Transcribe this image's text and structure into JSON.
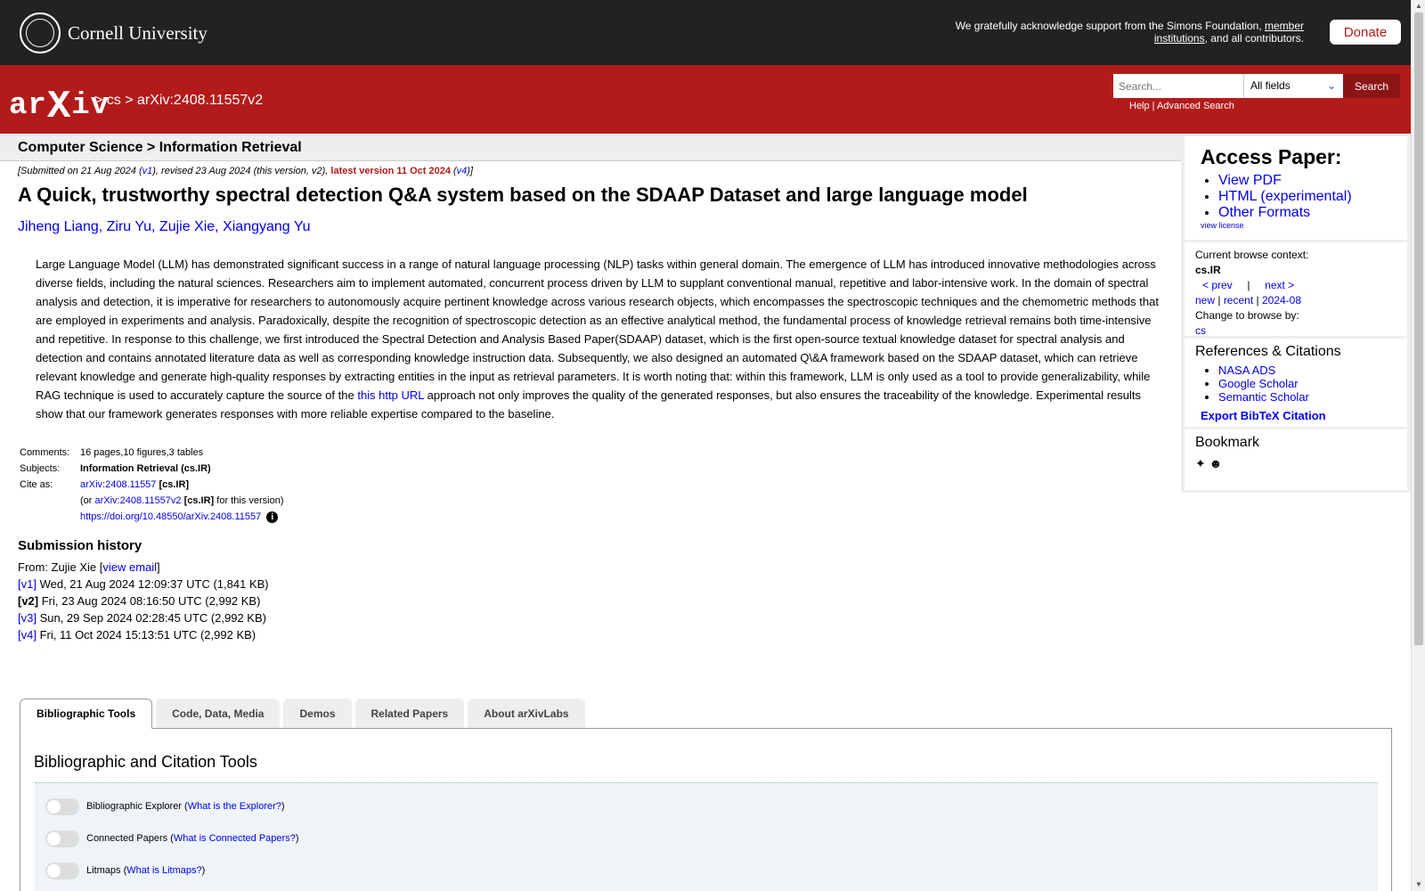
{
  "cornell": {
    "wordmark": "Cornell University",
    "support_pre": "We gratefully acknowledge support from the Simons Foundation, ",
    "support_link": "member institutions",
    "support_post": ", and all contributors.",
    "donate": "Donate"
  },
  "arxiv": {
    "breadcrumb": "> cs > arXiv:2408.11557v2",
    "search_placeholder": "Search...",
    "field_select": "All fields",
    "search_button": "Search",
    "help": "Help",
    "sep": " | ",
    "advanced": "Advanced Search"
  },
  "subject_header": "Computer Science > Information Retrieval",
  "dateline": {
    "part1": "[Submitted on 21 Aug 2024 (",
    "v1": "v1",
    "part2": "), revised 23 Aug 2024 (this version, v2), ",
    "latest": "latest version 11 Oct 2024",
    "part3": " (",
    "v4": "v4",
    "part4": ")]"
  },
  "title": "A Quick, trustworthy spectral detection Q&A system based on the SDAAP Dataset and large language model",
  "authors": "Jiheng Liang, Ziru Yu, Zujie Xie, Xiangyang Yu",
  "abstract": {
    "text_pre": "Large Language Model (LLM) has demonstrated significant success in a range of natural language processing (NLP) tasks within general domain. The emergence of LLM has introduced innovative methodologies across diverse fields, including the natural sciences. Researchers aim to implement automated, concurrent process driven by LLM to supplant conventional manual, repetitive and labor-intensive work. In the domain of spectral analysis and detection, it is imperative for researchers to autonomously acquire pertinent knowledge across various research objects, which encompasses the spectroscopic techniques and the chemometric methods that are employed in experiments and analysis. Paradoxically, despite the recognition of spectroscopic detection as an effective analytical method, the fundamental process of knowledge retrieval remains both time-intensive and repetitive. In response to this challenge, we first introduced the Spectral Detection and Analysis Based Paper(SDAAP) dataset, which is the first open-source textual knowledge dataset for spectral analysis and detection and contains annotated literature data as well as corresponding knowledge instruction data. Subsequently, we also designed an automated Q\\&A framework based on the SDAAP dataset, which can retrieve relevant knowledge and generate high-quality responses by extracting entities in the input as retrieval parameters. It is worth noting that: within this framework, LLM is only used as a tool to provide generalizability, while RAG technique is used to accurately capture the source of the ",
    "link": "this http URL",
    "text_post": " approach not only improves the quality of the generated responses, but also ensures the traceability of the knowledge. Experimental results show that our framework generates responses with more reliable expertise compared to the baseline."
  },
  "meta": {
    "comments_label": "Comments:",
    "comments": "16 pages,10 figures,3 tables",
    "subjects_label": "Subjects:",
    "subjects": "Information Retrieval (cs.IR)",
    "cite_label": "Cite as:",
    "cite_link": "arXiv:2408.11557",
    "cite_tag": " [cs.IR]",
    "or_pre": "(or ",
    "or_link": "arXiv:2408.11557v2",
    "or_tag": " [cs.IR]",
    "or_post": " for this version)",
    "doi": "https://doi.org/10.48550/arXiv.2408.11557"
  },
  "history": {
    "title": "Submission history",
    "from_pre": "From: Zujie Xie [",
    "from_link": "view email",
    "from_post": "]",
    "versions": [
      {
        "tag": "[v1]",
        "text": " Wed, 21 Aug 2024 12:09:37 UTC (1,841 KB)"
      },
      {
        "tag": "[v2]",
        "text": " Fri, 23 Aug 2024 08:16:50 UTC (2,992 KB)"
      },
      {
        "tag": "[v3]",
        "text": " Sun, 29 Sep 2024 02:28:45 UTC (2,992 KB)"
      },
      {
        "tag": "[v4]",
        "text": " Fri, 11 Oct 2024 15:13:51 UTC (2,992 KB)"
      }
    ]
  },
  "sidebar": {
    "access_title": "Access Paper:",
    "access_links": [
      "View PDF",
      "HTML (experimental)",
      "Other Formats"
    ],
    "view_license": "view license",
    "context_label": "Current browse context:",
    "context": "cs.IR",
    "prev": "< prev",
    "bar": "|",
    "next": "next >",
    "new": "new",
    "recent": "recent",
    "month": "2024-08",
    "change_label": "Change to browse by:",
    "change_cs": "cs",
    "refs_title": "References & Citations",
    "refs": [
      "NASA ADS",
      "Google Scholar",
      "Semantic Scholar"
    ],
    "export": "Export BibTeX Citation",
    "bookmark_title": "Bookmark"
  },
  "tabs": [
    "Bibliographic Tools",
    "Code, Data, Media",
    "Demos",
    "Related Papers",
    "About arXivLabs"
  ],
  "panel": {
    "title": "Bibliographic and Citation Tools",
    "tools": [
      {
        "label": "Bibliographic Explorer (",
        "link": "What is the Explorer?",
        "close": ")"
      },
      {
        "label": "Connected Papers (",
        "link": "What is Connected Papers?",
        "close": ")"
      },
      {
        "label": "Litmaps (",
        "link": "What is Litmaps?",
        "close": ")"
      }
    ]
  },
  "colors": {
    "arxiv_red": "#b31b1b",
    "cornell_dark": "#222222",
    "link_blue": "#0000ee"
  },
  "icons": [
    "cornell-seal-icon",
    "arxiv-logo-icon",
    "chevron-down-icon",
    "info-icon",
    "bibsonomy-icon",
    "reddit-icon"
  ]
}
